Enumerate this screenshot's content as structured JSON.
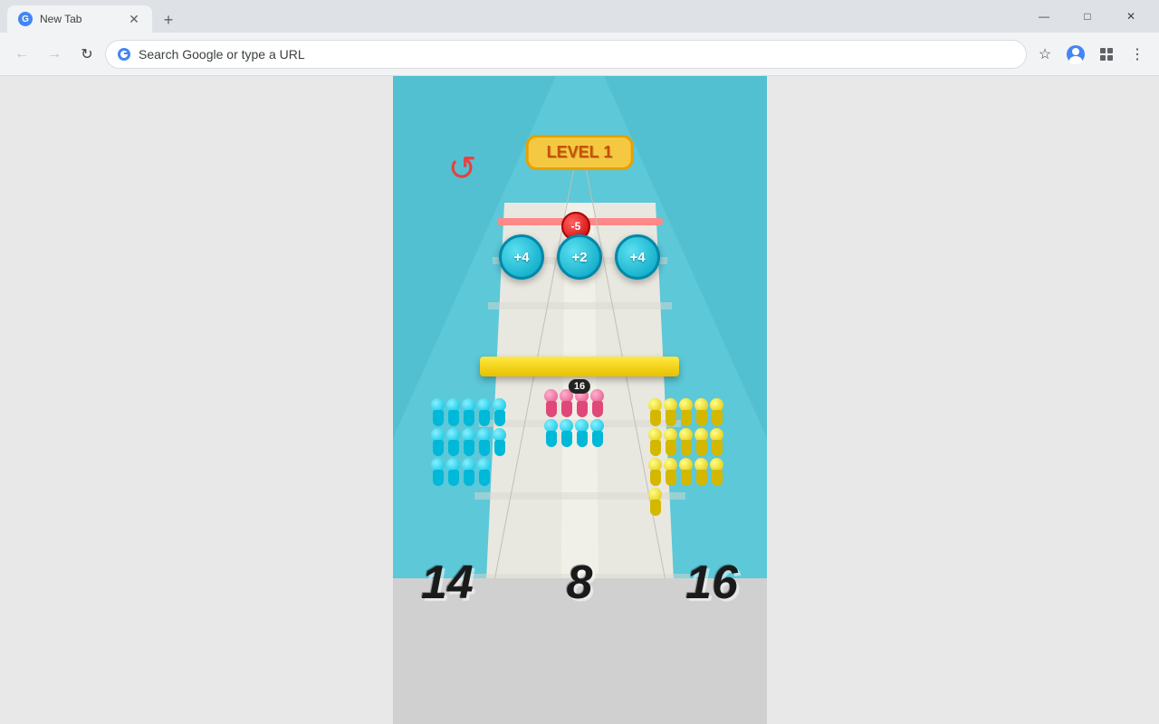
{
  "browser": {
    "tab_title": "New Tab",
    "address_placeholder": "Search Google or type a URL",
    "address_text": "Search Google or type a URL"
  },
  "game": {
    "level": "LEVEL 1",
    "restart_label": "↺",
    "penalty_ball": "-5",
    "boost_balls": [
      "+4",
      "+2",
      "+4"
    ],
    "counts": {
      "left": "14",
      "center": "8",
      "right": "16"
    },
    "center_badge": "16"
  },
  "window_controls": {
    "minimize": "—",
    "maximize": "□",
    "close": "✕"
  }
}
